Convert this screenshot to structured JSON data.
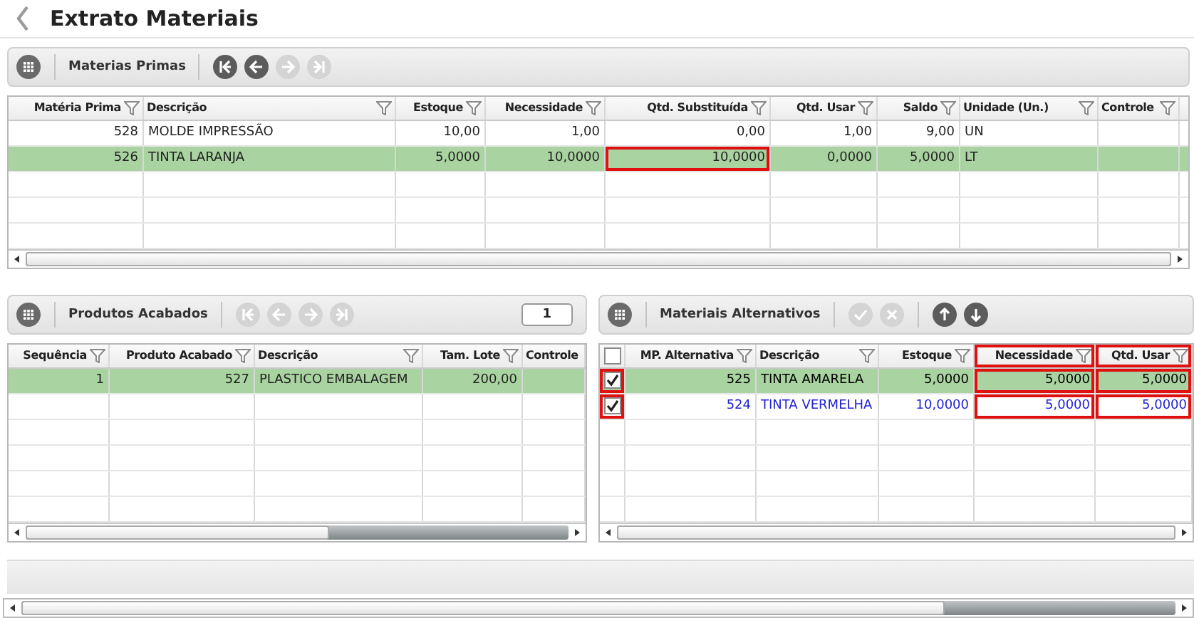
{
  "window": {
    "title": "Extrato Materiais"
  },
  "materias_primas": {
    "title": "Materias Primas",
    "nav_buttons": [
      {
        "kind": "first",
        "disabled": false
      },
      {
        "kind": "prev",
        "disabled": false
      },
      {
        "kind": "next",
        "disabled": true
      },
      {
        "kind": "last",
        "disabled": true
      }
    ],
    "columns": [
      {
        "label": "Matéria Prima",
        "numeric": true
      },
      {
        "label": "Descrição",
        "numeric": false
      },
      {
        "label": "Estoque",
        "numeric": true
      },
      {
        "label": "Necessidade",
        "numeric": true
      },
      {
        "label": "Qtd. Substituída",
        "numeric": true
      },
      {
        "label": "Qtd. Usar",
        "numeric": true
      },
      {
        "label": "Saldo",
        "numeric": true
      },
      {
        "label": "Unidade (Un.)",
        "numeric": false
      },
      {
        "label": "Controle",
        "numeric": false
      }
    ],
    "rows": [
      {
        "selected": false,
        "cells": [
          {
            "text": "528",
            "marked": false
          },
          {
            "text": "MOLDE IMPRESSÃO",
            "marked": false
          },
          {
            "text": "10,00",
            "marked": false
          },
          {
            "text": "1,00",
            "marked": false
          },
          {
            "text": "0,00",
            "marked": false
          },
          {
            "text": "1,00",
            "marked": false
          },
          {
            "text": "9,00",
            "marked": false
          },
          {
            "text": "UN",
            "marked": false
          }
        ]
      },
      {
        "selected": true,
        "cells": [
          {
            "text": "526",
            "marked": false
          },
          {
            "text": "TINTA LARANJA",
            "marked": false
          },
          {
            "text": "5,0000",
            "marked": false
          },
          {
            "text": "10,0000",
            "marked": false
          },
          {
            "text": "10,0000",
            "marked": true
          },
          {
            "text": "0,0000",
            "marked": false
          },
          {
            "text": "5,0000",
            "marked": false
          },
          {
            "text": "LT",
            "marked": false
          }
        ]
      }
    ]
  },
  "produtos_acabados": {
    "title": "Produtos Acabados",
    "page": "1",
    "nav_buttons": [
      {
        "kind": "first",
        "disabled": true
      },
      {
        "kind": "prev",
        "disabled": true
      },
      {
        "kind": "next",
        "disabled": true
      },
      {
        "kind": "last",
        "disabled": true
      }
    ],
    "columns": [
      {
        "label": "Sequência",
        "numeric": true,
        "filter": true
      },
      {
        "label": "Produto Acabado",
        "numeric": true,
        "filter": true
      },
      {
        "label": "Descrição",
        "numeric": false,
        "filter": true
      },
      {
        "label": "Tam. Lote",
        "numeric": true,
        "filter": true
      },
      {
        "label": "Controle",
        "numeric": false,
        "filter": false
      }
    ],
    "rows": [
      {
        "selected": true,
        "cells": [
          {
            "text": "1",
            "marked": false
          },
          {
            "text": "527",
            "marked": false
          },
          {
            "text": "PLASTICO EMBALAGEM",
            "marked": false
          },
          {
            "text": "200,00",
            "marked": false
          }
        ]
      }
    ]
  },
  "materiais_alternativos": {
    "title": "Materiais Alternativos",
    "tool_buttons": [
      {
        "kind": "confirm",
        "disabled": true
      },
      {
        "kind": "cancel",
        "disabled": true
      },
      {
        "kind": "up",
        "disabled": false
      },
      {
        "kind": "down",
        "disabled": false
      }
    ],
    "select_all": {
      "checked": false
    },
    "columns": [
      {
        "label": "MP. Alternativa",
        "numeric": true,
        "marked": false
      },
      {
        "label": "Descrição",
        "numeric": false,
        "marked": false
      },
      {
        "label": "Estoque",
        "numeric": true,
        "marked": false
      },
      {
        "label": "Necessidade",
        "numeric": true,
        "marked": true
      },
      {
        "label": "Qtd. Usar",
        "numeric": true,
        "marked": true
      }
    ],
    "rows": [
      {
        "selected": true,
        "checked": true,
        "check_marked": true,
        "color": "#000000",
        "cells": [
          {
            "text": "525",
            "marked": false
          },
          {
            "text": "TINTA AMARELA",
            "marked": false
          },
          {
            "text": "5,0000",
            "marked": false
          },
          {
            "text": "5,0000",
            "marked": true
          },
          {
            "text": "5,0000",
            "marked": true
          }
        ]
      },
      {
        "selected": false,
        "checked": true,
        "check_marked": true,
        "color": "#2020d8",
        "cells": [
          {
            "text": "524",
            "marked": false
          },
          {
            "text": "TINTA VERMELHA",
            "marked": false
          },
          {
            "text": "10,0000",
            "marked": false
          },
          {
            "text": "5,0000",
            "marked": true
          },
          {
            "text": "5,0000",
            "marked": true
          }
        ]
      }
    ]
  }
}
